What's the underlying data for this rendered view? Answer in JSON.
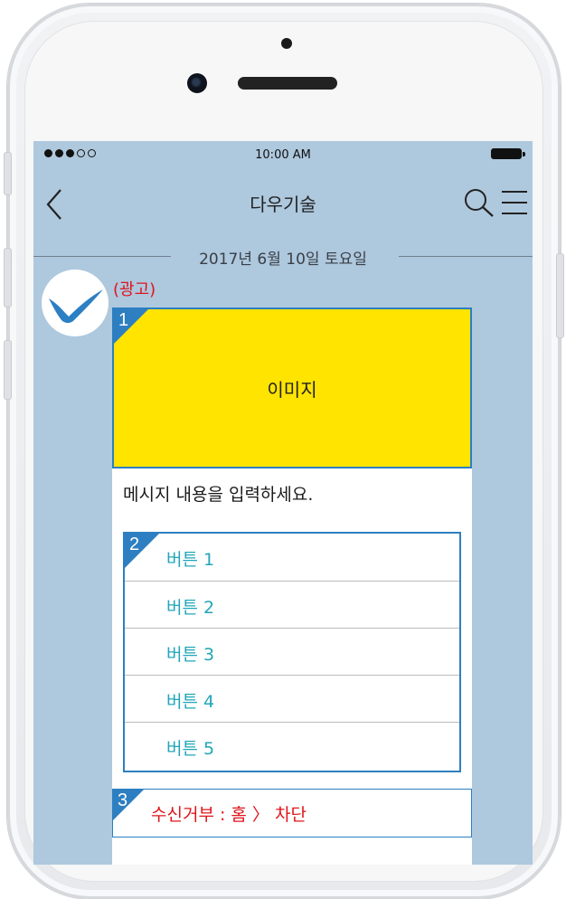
{
  "status_bar": {
    "signal": "●●●○○",
    "time": "10:00 AM",
    "battery_icon": "battery-full"
  },
  "header": {
    "back_icon": "chevron-left",
    "title": "다우기술",
    "search_icon": "search",
    "menu_icon": "hamburger-menu"
  },
  "date_separator": "2017년 6월 10일 토요일",
  "sender": {
    "avatar_icon": "brand-checkmark-logo",
    "ad_label": "(광고)"
  },
  "message": {
    "image": {
      "number": "1",
      "label": "이미지",
      "bg_color": "#ffe400"
    },
    "text": "메시지 내용을 입력하세요.",
    "buttons_number": "2",
    "buttons": [
      {
        "label": "버튼 1"
      },
      {
        "label": "버튼 2"
      },
      {
        "label": "버튼 3"
      },
      {
        "label": "버튼 4"
      },
      {
        "label": "버튼 5"
      }
    ],
    "reject": {
      "number": "3",
      "label": "수신거부 : 홈 〉 차단"
    }
  },
  "colors": {
    "accent_blue": "#2d7fc1",
    "screen_bg": "#aec8de",
    "button_text": "#22a6b8",
    "ad_red": "#e0141b"
  }
}
